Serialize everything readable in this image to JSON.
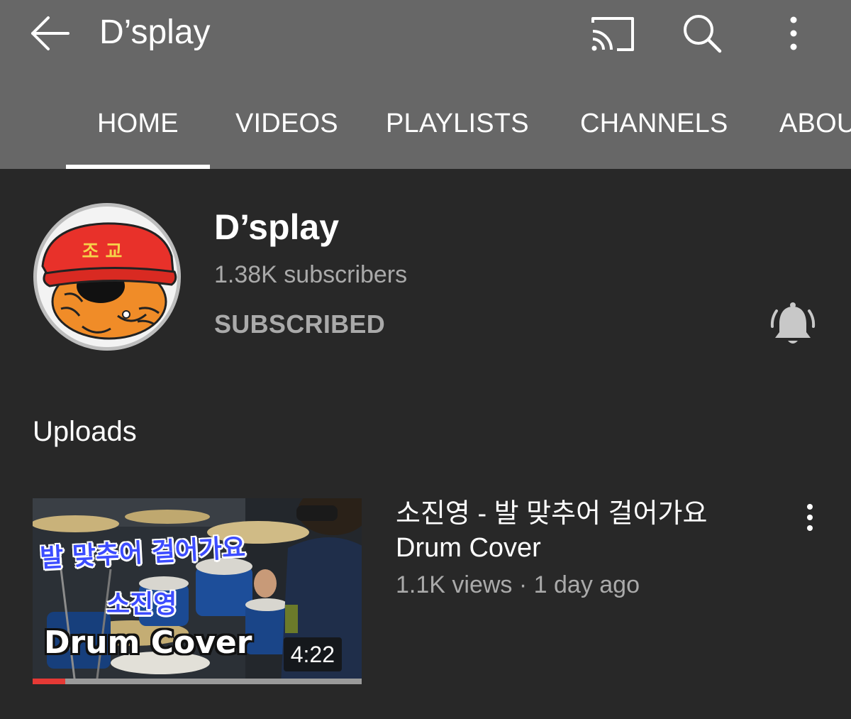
{
  "app_bar": {
    "title": "D’splay",
    "back_icon": "arrow-left-icon",
    "cast_icon": "cast-icon",
    "search_icon": "search-icon",
    "more_icon": "more-vert-icon"
  },
  "tabs": [
    {
      "label": "HOME",
      "active": true
    },
    {
      "label": "VIDEOS",
      "active": false
    },
    {
      "label": "PLAYLISTS",
      "active": false
    },
    {
      "label": "CHANNELS",
      "active": false
    },
    {
      "label": "ABOUT",
      "active": false
    }
  ],
  "channel": {
    "name": "D’splay",
    "subscribers": "1.38K subscribers",
    "subscribe_state": "SUBSCRIBED",
    "bell_icon": "notification-bell-icon",
    "avatar_text": "조 교"
  },
  "uploads": {
    "title": "Uploads",
    "videos": [
      {
        "title": "소진영 - 발 맞추어 걸어가요 Drum Cover",
        "views": "1.1K views",
        "separator": "·",
        "age": "1 day ago",
        "duration": "4:22",
        "watched_fraction": 0.1,
        "thumbnail_text_line1": "발 맞추어 걸어가요",
        "thumbnail_text_line2": "소진영",
        "thumbnail_text_line3": "Drum Cover"
      }
    ]
  },
  "colors": {
    "app_bar_bg": "#676767",
    "page_bg": "#282828",
    "primary_text": "#ffffff",
    "secondary_text": "#aaaaaa",
    "progress_red": "#e53935"
  }
}
